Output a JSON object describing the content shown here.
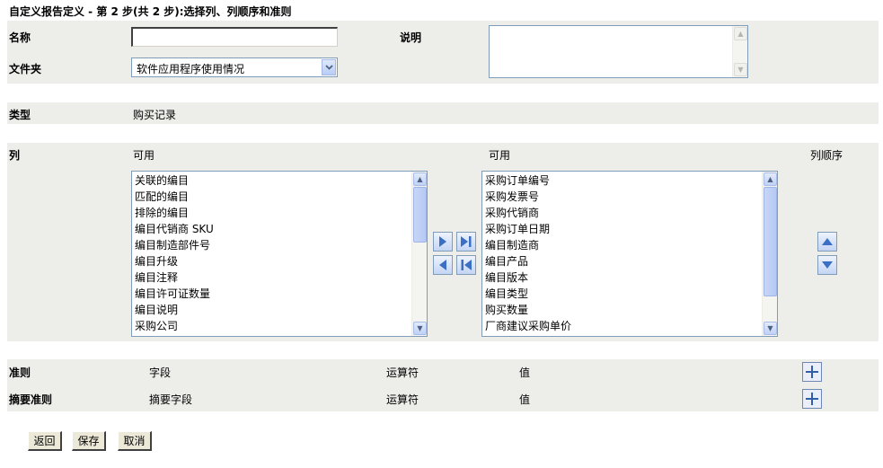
{
  "page_title": "自定义报告定义 - 第 2 步(共 2 步):选择列、列顺序和准则",
  "name_field": {
    "label": "名称",
    "value": ""
  },
  "description_field": {
    "label": "说明",
    "value": ""
  },
  "folder_field": {
    "label": "文件夹",
    "selected": "软件应用程序使用情况"
  },
  "type_field": {
    "label": "类型",
    "value": "购买记录"
  },
  "columns": {
    "label": "列",
    "available_header": "可用",
    "selected_header": "可用",
    "order_header": "列顺序",
    "available_items": [
      "关联的编目",
      "匹配的编目",
      "排除的编目",
      "编目代销商 SKU",
      "编目制造部件号",
      "编目升级",
      "编目注释",
      "编目许可证数量",
      "编目说明",
      "采购公司"
    ],
    "selected_items": [
      "采购订单编号",
      "采购发票号",
      "采购代销商",
      "采购订单日期",
      "编目制造商",
      "编目产品",
      "编目版本",
      "编目类型",
      "购买数量",
      "厂商建议采购单价"
    ]
  },
  "criteria": {
    "label": "准则",
    "field_header": "字段",
    "operator_header": "运算符",
    "value_header": "值"
  },
  "summary_criteria": {
    "label": "摘要准则",
    "field_header": "摘要字段",
    "operator_header": "运算符",
    "value_header": "值"
  },
  "buttons": {
    "back": "返回",
    "save": "保存",
    "cancel": "取消"
  },
  "icons": {
    "add_right": "arrow-right-icon",
    "add_all_right": "arrow-right-end-icon",
    "remove_left": "arrow-left-icon",
    "remove_all_left": "arrow-left-end-icon",
    "move_up": "triangle-up-icon",
    "move_down": "triangle-down-icon",
    "add_criteria": "plus-icon"
  },
  "colors": {
    "band": "#ededea",
    "arrow_blue": "#3a6fc4",
    "border_blue": "#7f9db9"
  }
}
